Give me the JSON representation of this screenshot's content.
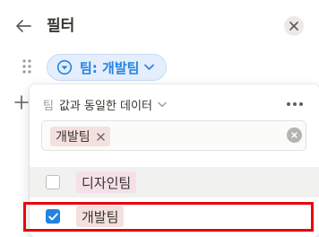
{
  "panel": {
    "title": "필터",
    "icons": {
      "back": "arrow-left-icon",
      "close": "close-icon",
      "drag": "drag-handle-icon",
      "add": "plus-icon"
    }
  },
  "filter_chip": {
    "label": "팀: 개발팀",
    "icon": "select-circle-icon",
    "color": "#2383e2"
  },
  "dropdown": {
    "property_name": "팀",
    "operator_label": "값과 동일한 데이터",
    "more_icon": "more-horizontal-icon",
    "selected_tokens": [
      {
        "label": "개발팀",
        "color": "#f4e0de"
      }
    ],
    "options": [
      {
        "label": "디자인팀",
        "checked": false,
        "color": "#f5e0e9"
      },
      {
        "label": "개발팀",
        "checked": true,
        "color": "#f4e0de"
      }
    ]
  },
  "colors": {
    "accent": "#2383e2",
    "highlight": "#e8040e"
  }
}
